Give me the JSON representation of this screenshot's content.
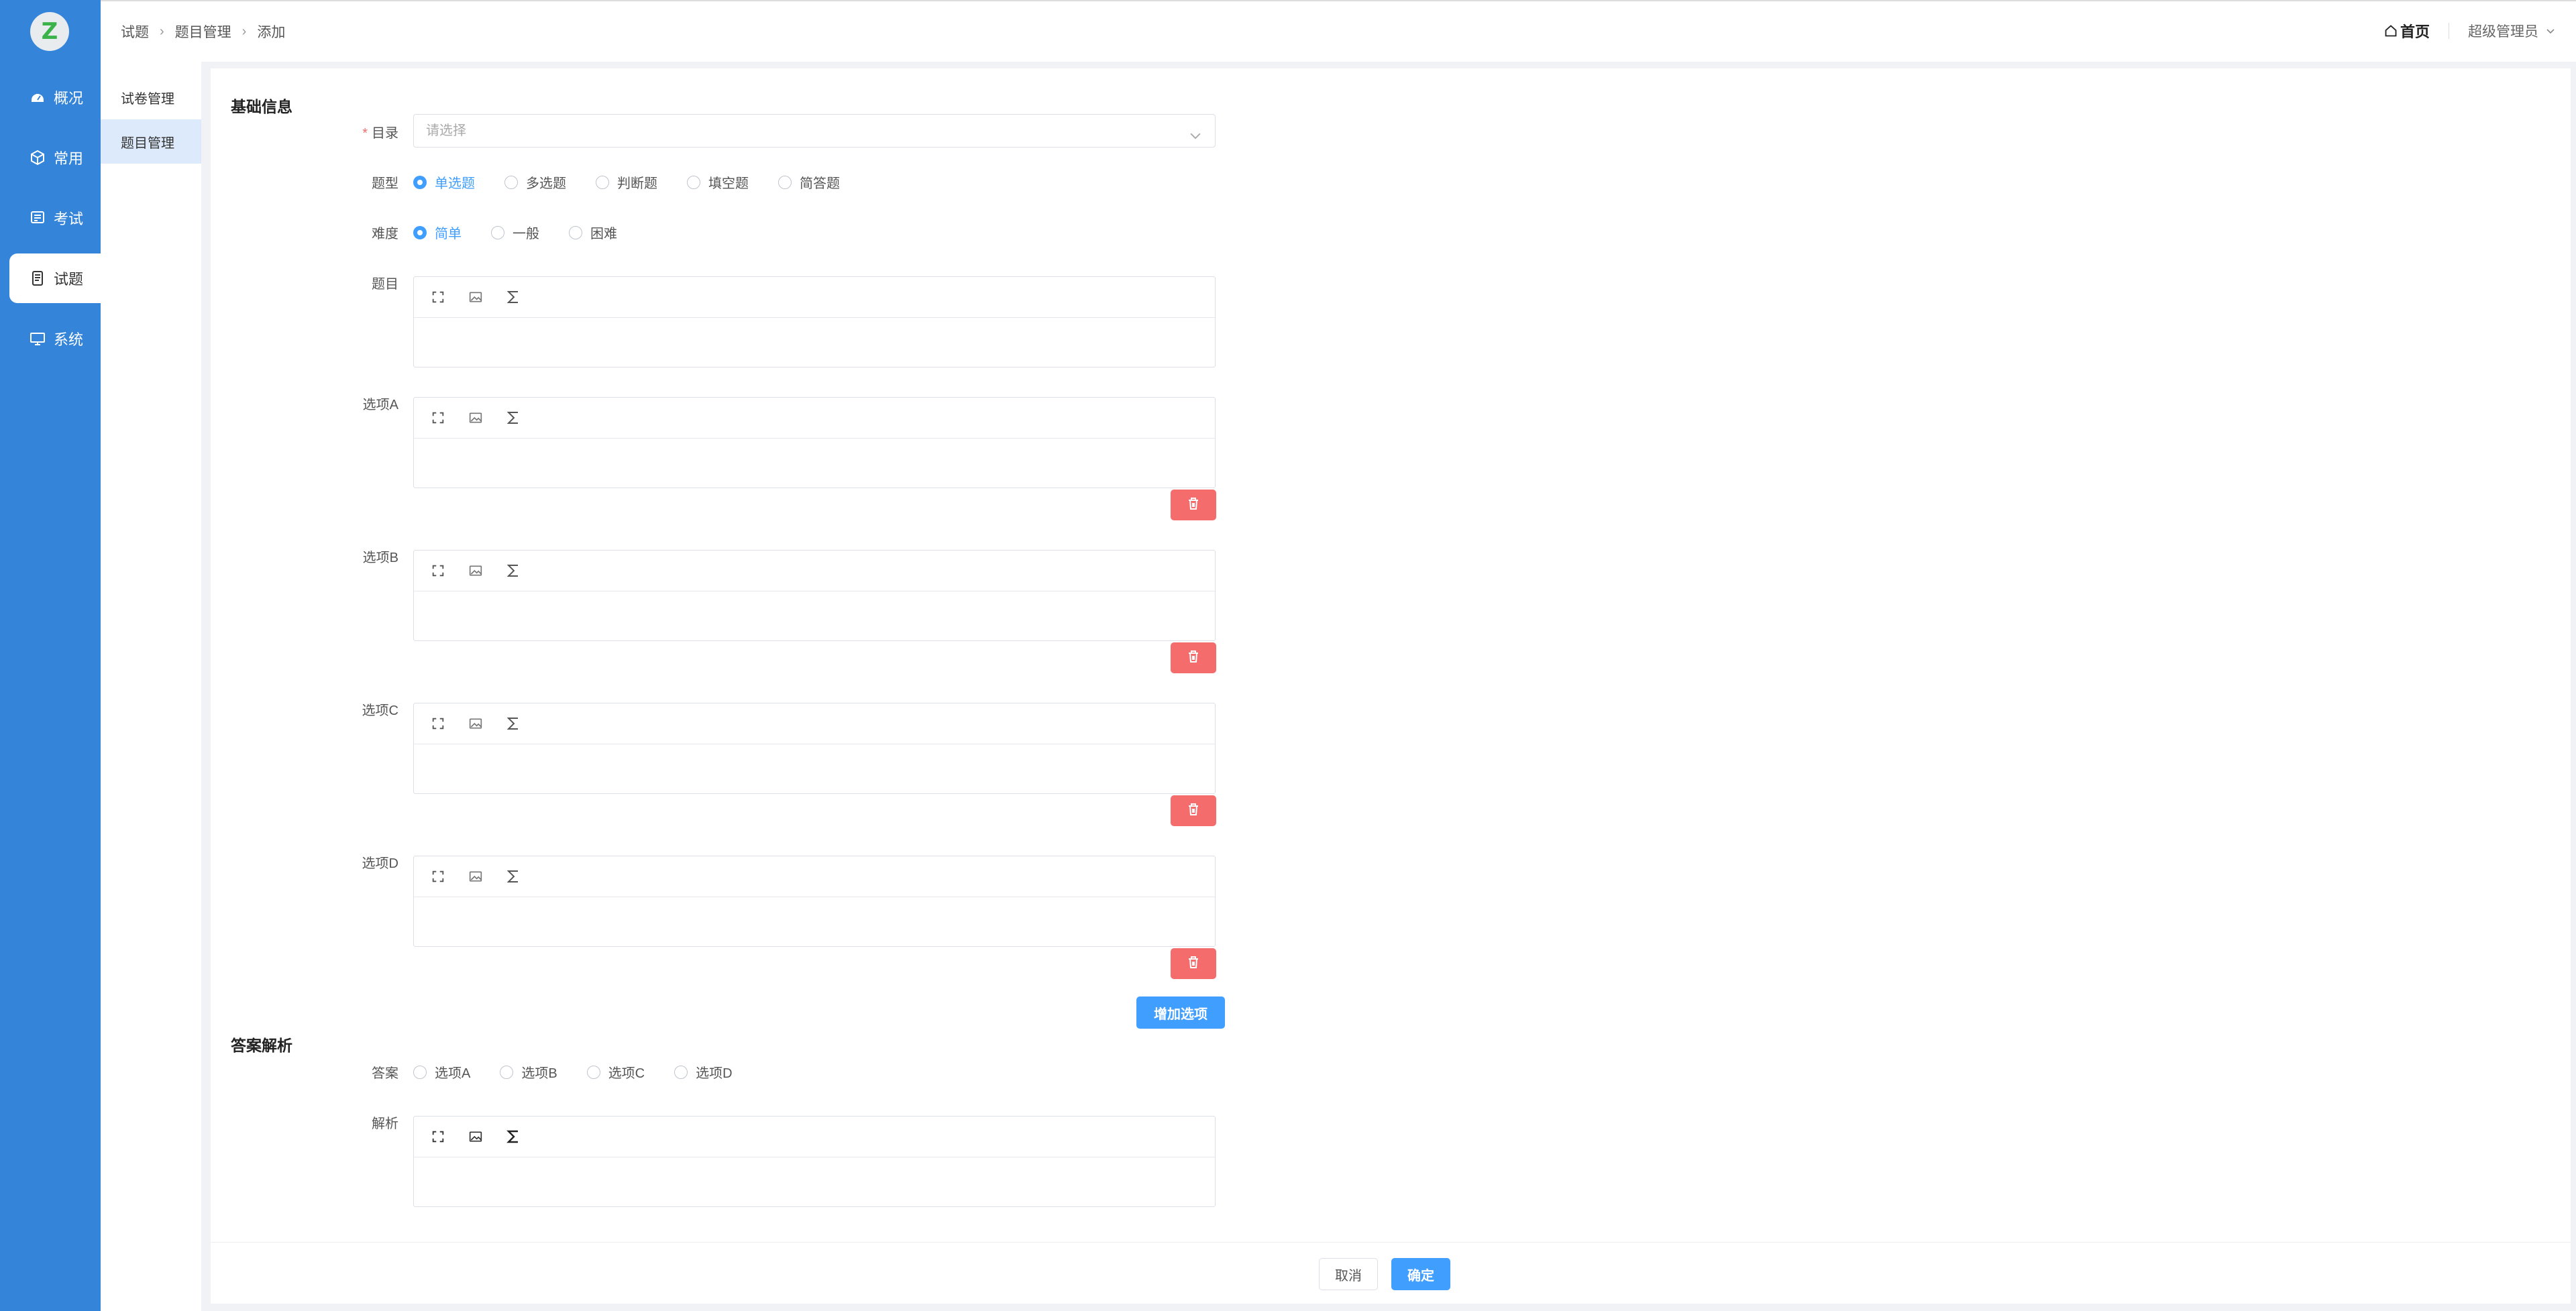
{
  "nav": {
    "logo_letter": "Z",
    "items": [
      {
        "label": "概况",
        "icon": "dashboard-icon"
      },
      {
        "label": "常用",
        "icon": "cube-icon"
      },
      {
        "label": "考试",
        "icon": "exam-icon"
      },
      {
        "label": "试题",
        "icon": "document-icon"
      },
      {
        "label": "系统",
        "icon": "monitor-icon"
      }
    ],
    "active_index": 3
  },
  "submenu": {
    "items": [
      {
        "label": "试卷管理"
      },
      {
        "label": "题目管理"
      }
    ],
    "active_index": 1
  },
  "header": {
    "breadcrumb": [
      "试题",
      "题目管理",
      "添加"
    ],
    "home_label": "首页",
    "user_label": "超级管理员"
  },
  "form": {
    "basic_title": "基础信息",
    "catalog": {
      "label": "目录",
      "placeholder": "请选择"
    },
    "type": {
      "label": "题型",
      "options": [
        "单选题",
        "多选题",
        "判断题",
        "填空题",
        "简答题"
      ],
      "selected": "单选题"
    },
    "difficulty": {
      "label": "难度",
      "options": [
        "简单",
        "一般",
        "困难"
      ],
      "selected": "简单"
    },
    "question_label": "题目",
    "options": [
      {
        "label": "选项A"
      },
      {
        "label": "选项B"
      },
      {
        "label": "选项C"
      },
      {
        "label": "选项D"
      }
    ],
    "add_option_label": "增加选项",
    "answer_title": "答案解析",
    "answer": {
      "label": "答案",
      "options": [
        "选项A",
        "选项B",
        "选项C",
        "选项D"
      ]
    },
    "analysis_label": "解析",
    "cancel_label": "取消",
    "confirm_label": "确定"
  },
  "colors": {
    "nav_bg": "#3485d9",
    "primary": "#409eff",
    "danger": "#f56c6c"
  }
}
